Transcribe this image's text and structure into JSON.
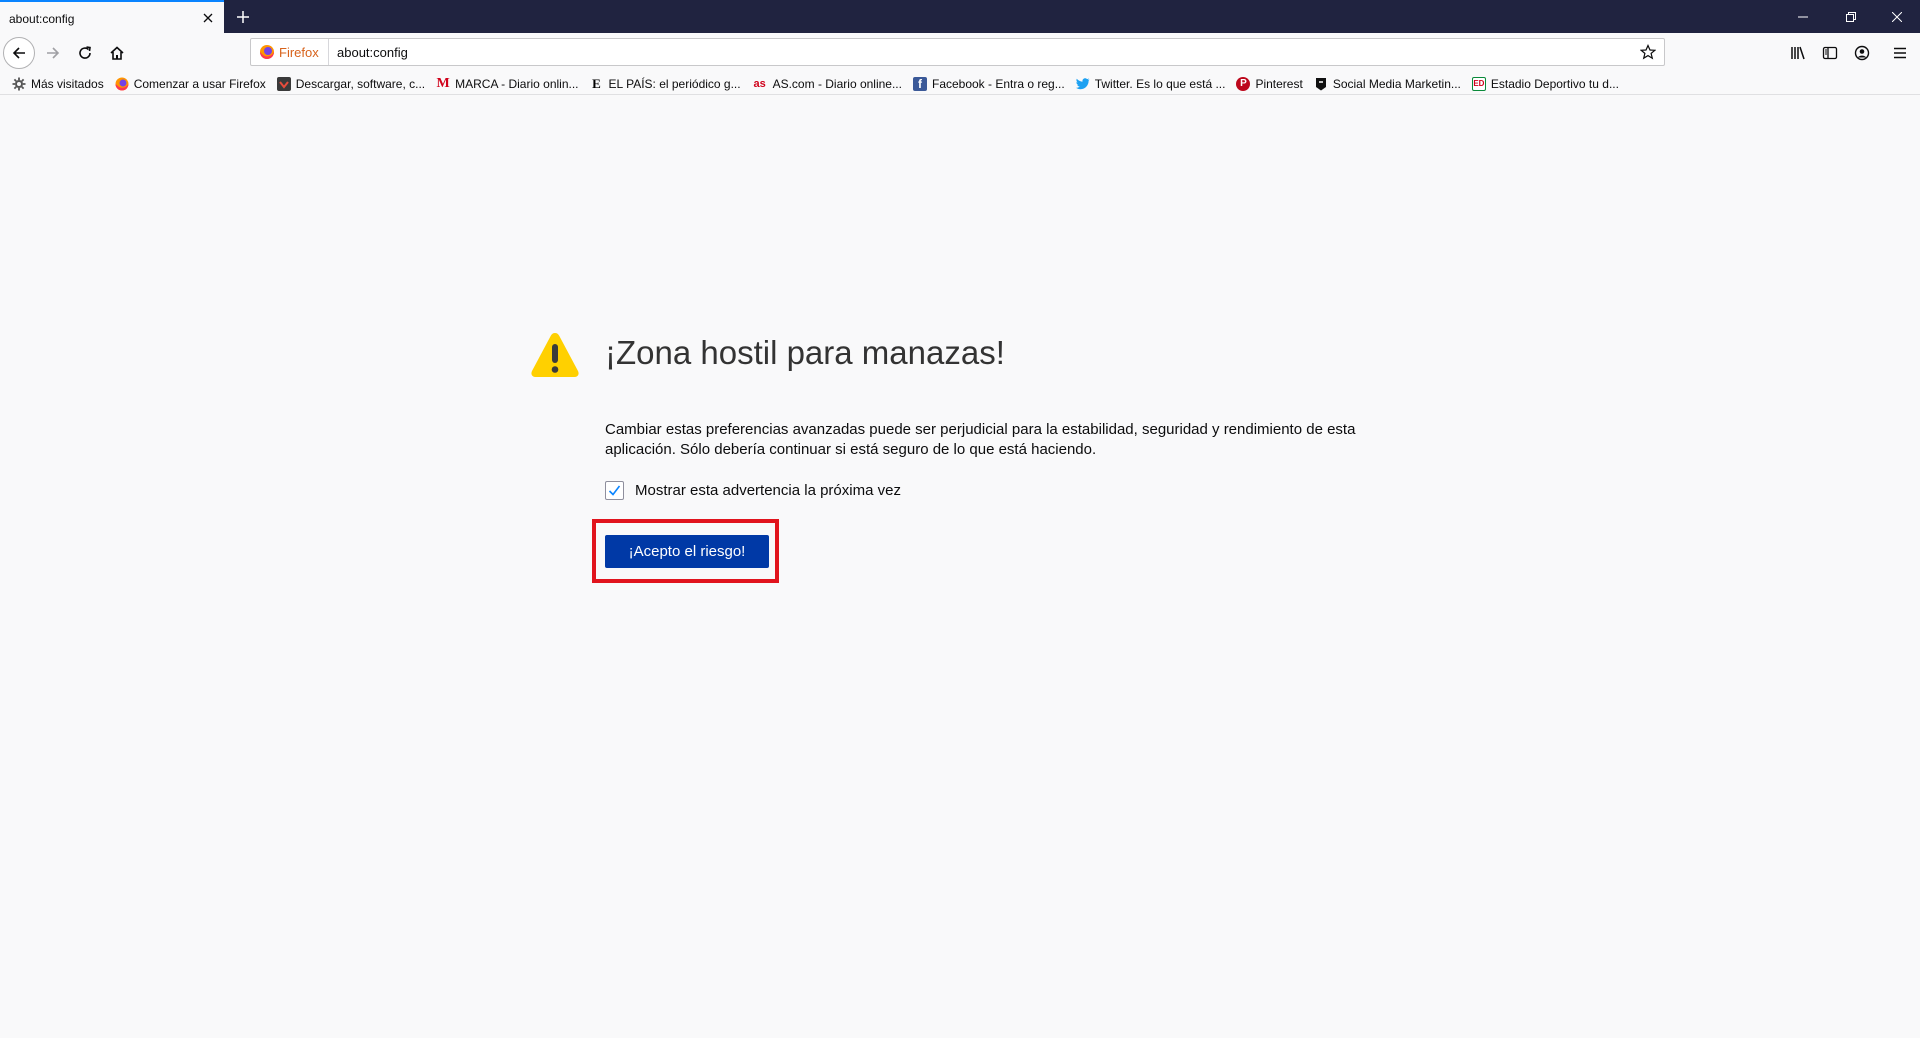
{
  "tab": {
    "title": "about:config"
  },
  "url_bar": {
    "identity_label": "Firefox",
    "url": "about:config"
  },
  "bookmarks": [
    {
      "label": "Más visitados",
      "icon": "gear-icon",
      "color": "#555555"
    },
    {
      "label": "Comenzar a usar Firefox",
      "icon": "firefox-icon",
      "color": "#e66000"
    },
    {
      "label": "Descargar, software, c...",
      "icon": "softonic-icon",
      "color": "#c0392b"
    },
    {
      "label": "MARCA - Diario onlin...",
      "icon": "marca-icon",
      "color": "#d0021b"
    },
    {
      "label": "EL PAÍS: el periódico g...",
      "icon": "elpais-icon",
      "color": "#000000"
    },
    {
      "label": "AS.com - Diario online...",
      "icon": "as-icon",
      "color": "#d0021b"
    },
    {
      "label": "Facebook - Entra o reg...",
      "icon": "facebook-icon",
      "color": "#3b5998"
    },
    {
      "label": "Twitter. Es lo que está ...",
      "icon": "twitter-icon",
      "color": "#1da1f2"
    },
    {
      "label": "Pinterest",
      "icon": "pinterest-icon",
      "color": "#bd081c"
    },
    {
      "label": "Social Media Marketin...",
      "icon": "socialmedia-icon",
      "color": "#000000"
    },
    {
      "label": "Estadio Deportivo tu d...",
      "icon": "estadio-icon",
      "color": "#0a8a3a"
    }
  ],
  "warning": {
    "title": "¡Zona hostil para manazas!",
    "description": "Cambiar estas preferencias avanzadas puede ser perjudicial para la estabilidad, seguridad y rendimiento de esta aplicación. Sólo debería continuar si está seguro de lo que está haciendo.",
    "checkbox_label": "Mostrar esta advertencia la próxima vez",
    "checkbox_checked": true,
    "accept_button": "¡Acepto el riesgo!"
  },
  "colors": {
    "accent": "#0039a6",
    "highlight": "#e1141d",
    "warning_icon": "#ffd000",
    "titlebar": "#202340"
  }
}
